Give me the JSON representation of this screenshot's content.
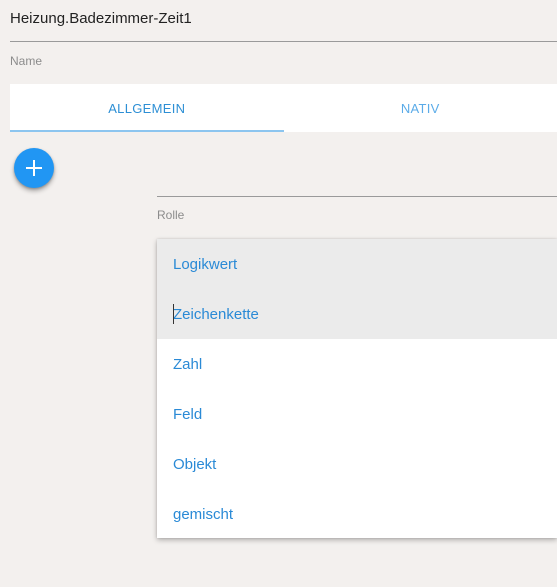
{
  "name_field": {
    "value": "Heizung.Badezimmer-Zeit1",
    "label": "Name"
  },
  "tabs": [
    {
      "label": "ALLGEMEIN",
      "active": true
    },
    {
      "label": "NATIV",
      "active": false
    }
  ],
  "add_button": {
    "icon": "plus-icon"
  },
  "role_field": {
    "label": "Rolle"
  },
  "role_dropdown": {
    "options": [
      {
        "label": "Logikwert"
      },
      {
        "label": "Zeichenkette"
      },
      {
        "label": "Zahl"
      },
      {
        "label": "Feld"
      },
      {
        "label": "Objekt"
      },
      {
        "label": "gemischt"
      }
    ]
  },
  "colors": {
    "accent": "#2196f3",
    "link_text": "#2a8ad6",
    "background": "#f3f0ee",
    "highlight": "#ebebeb"
  }
}
